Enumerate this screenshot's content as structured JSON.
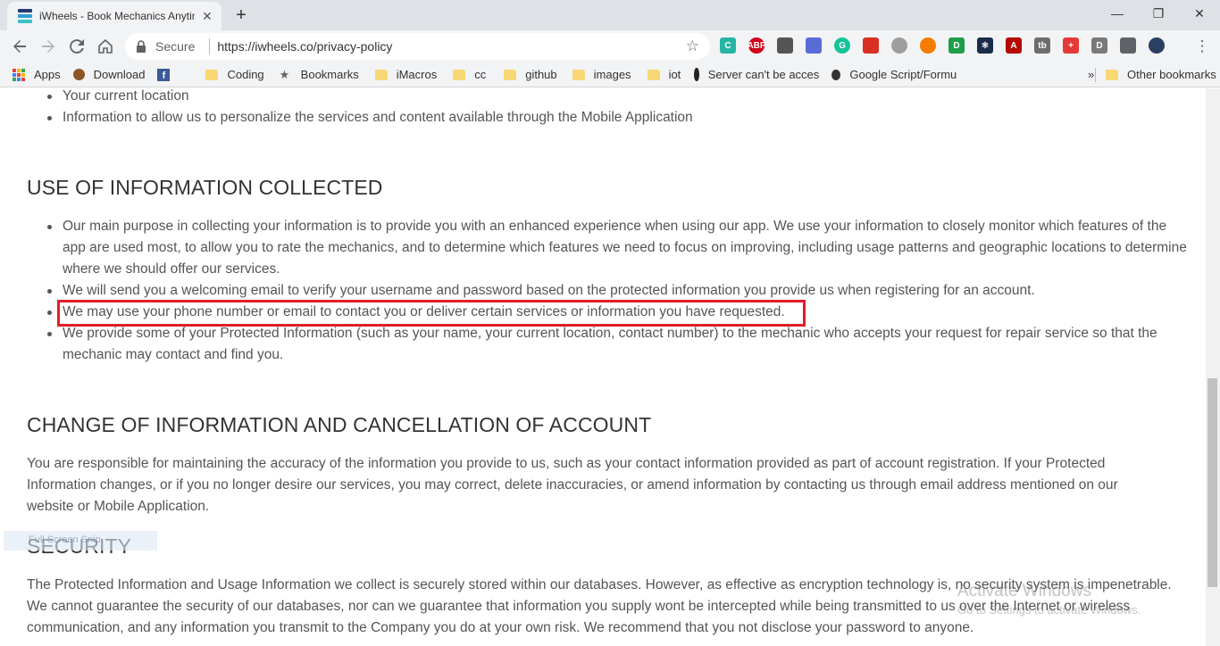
{
  "browser": {
    "tab_title": "iWheels - Book Mechanics Anytim",
    "tab_close": "✕",
    "new_tab": "+",
    "window_controls": {
      "minimize": "—",
      "restore": "❐",
      "close": "✕"
    },
    "omnibox": {
      "secure_label": "Secure",
      "url": "https://iwheels.co/privacy-policy"
    },
    "extensions": [
      {
        "icon": "c-icon",
        "text": "C",
        "color": "#26b5a4"
      },
      {
        "icon": "adblock-icon",
        "text": "ABP",
        "color": "#d0021b"
      },
      {
        "icon": "eyedropper-icon",
        "text": "",
        "color": "#555"
      },
      {
        "icon": "stamp-icon",
        "text": "",
        "color": "#5b6bd6"
      },
      {
        "icon": "grammarly-icon",
        "text": "G",
        "color": "#15c39a"
      },
      {
        "icon": "red-square-icon",
        "text": "",
        "color": "#d93025"
      },
      {
        "icon": "gray-circle-icon",
        "text": "",
        "color": "#9e9e9e"
      },
      {
        "icon": "orange-circle-icon",
        "text": "",
        "color": "#f57c00"
      },
      {
        "icon": "green-d-icon",
        "text": "D",
        "color": "#1e9e4a"
      },
      {
        "icon": "react-icon",
        "text": "⚛",
        "color": "#1a2b4c"
      },
      {
        "icon": "pdf-icon",
        "text": "A",
        "color": "#b30b00"
      },
      {
        "icon": "tb-icon",
        "text": "tb",
        "color": "#6d6d6d"
      },
      {
        "icon": "red-cross-icon",
        "text": "+",
        "color": "#e53935"
      },
      {
        "icon": "d-box-icon",
        "text": "D",
        "color": "#7a7a7a"
      },
      {
        "icon": "cast-icon",
        "text": "",
        "color": "#5f6368"
      },
      {
        "icon": "profile-avatar-icon",
        "text": "",
        "color": "#2b3f63"
      }
    ],
    "bookmarks": [
      {
        "label": "Apps",
        "icon": "apps-grid-icon"
      },
      {
        "label": "Download",
        "icon": "download-icon"
      },
      {
        "label": "",
        "icon": "facebook-icon"
      },
      {
        "label": "Coding",
        "icon": "folder-icon"
      },
      {
        "label": "Bookmarks",
        "icon": "star-icon"
      },
      {
        "label": "iMacros",
        "icon": "folder-icon"
      },
      {
        "label": "cc",
        "icon": "folder-icon"
      },
      {
        "label": "github",
        "icon": "folder-icon"
      },
      {
        "label": "images",
        "icon": "folder-icon"
      },
      {
        "label": "iot",
        "icon": "folder-icon"
      },
      {
        "label": "Server can't be acces",
        "icon": "github-icon"
      },
      {
        "label": "Google Script/Formu",
        "icon": "gear-icon"
      }
    ],
    "bookmarks_overflow": "»",
    "other_bookmarks": "Other bookmarks"
  },
  "page": {
    "top_bullets": [
      "Your current location",
      "Information to allow us to personalize the services and content available through the Mobile Application"
    ],
    "use_section": {
      "title": "USE OF INFORMATION COLLECTED",
      "bullets": [
        "Our main purpose in collecting your information is to provide you with an enhanced experience when using our app. We use your information to closely monitor which features of the app are used most, to allow you to rate the mechanics, and to determine which features we need to focus on improving, including usage patterns and geographic locations to determine where we should offer our services.",
        "We will send you a welcoming email to verify your username and password based on the protected information you provide us when registering for an account.",
        "We may use your phone number or email to contact you or deliver certain services or information you have requested.",
        "We provide some of your Protected Information (such as your name, your current location, contact number) to the mechanic who accepts your request for repair service so that the mechanic may contact and find you."
      ]
    },
    "change_section": {
      "title": "CHANGE OF INFORMATION AND CANCELLATION OF ACCOUNT",
      "text": "You are responsible for maintaining the accuracy of the information you provide to us, such as your contact information provided as part of account registration. If your Protected Information changes, or if you no longer desire our services, you may correct, delete inaccuracies, or amend information by contacting us through email address mentioned on our website or Mobile Application."
    },
    "security_section": {
      "title": "SECURITY",
      "text": "The Protected Information and Usage Information we collect is securely stored within our databases. However, as effective as encryption technology is, no security system is impenetrable. We cannot guarantee the security of our databases, nor can we guarantee that information you supply wont be intercepted while being transmitted to us over the Internet or wireless communication, and any information you transmit to the Company you do at your own risk. We recommend that you not disclose your password to anyone."
    },
    "ghost_overlay": "Full Screen Snip",
    "watermark": {
      "title": "Activate Windows",
      "subtitle": "Go to Settings to activate Windows."
    },
    "highlight_color": "#e01e28"
  }
}
